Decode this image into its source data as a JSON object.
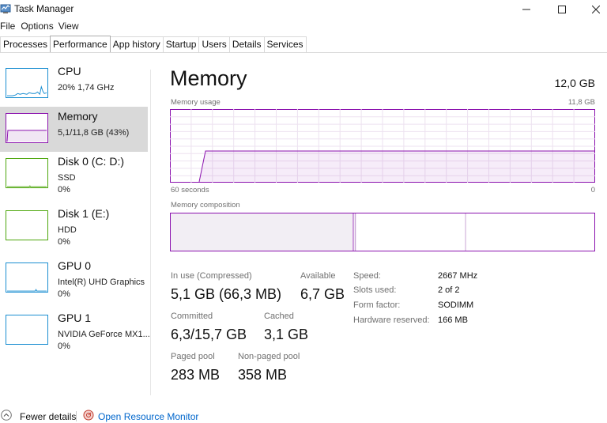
{
  "window": {
    "title": "Task Manager",
    "icon": "task-manager-icon",
    "controls": [
      "minimize-icon",
      "maximize-icon",
      "close-icon"
    ]
  },
  "menu": [
    "File",
    "Options",
    "View"
  ],
  "tabs": [
    {
      "label": "Processes",
      "active": false
    },
    {
      "label": "Performance",
      "active": true
    },
    {
      "label": "App history",
      "active": false
    },
    {
      "label": "Startup",
      "active": false
    },
    {
      "label": "Users",
      "active": false
    },
    {
      "label": "Details",
      "active": false
    },
    {
      "label": "Services",
      "active": false
    }
  ],
  "sidebar": [
    {
      "title": "CPU",
      "lines": [
        "20%  1,74 GHz"
      ],
      "color": "#1a8ed1",
      "selected": false
    },
    {
      "title": "Memory",
      "lines": [
        "5,1/11,8 GB (43%)"
      ],
      "color": "#8b12ae",
      "selected": true
    },
    {
      "title": "Disk 0 (C: D:)",
      "lines": [
        "SSD",
        "0%"
      ],
      "color": "#4da60c",
      "selected": false
    },
    {
      "title": "Disk 1 (E:)",
      "lines": [
        "HDD",
        "0%"
      ],
      "color": "#4da60c",
      "selected": false
    },
    {
      "title": "GPU 0",
      "lines": [
        "Intel(R) UHD Graphics",
        "0%"
      ],
      "color": "#1a8ed1",
      "selected": false
    },
    {
      "title": "GPU 1",
      "lines": [
        "NVIDIA GeForce MX1...",
        "0%"
      ],
      "color": "#1a8ed1",
      "selected": false
    }
  ],
  "main": {
    "title": "Memory",
    "capacity": "12,0 GB",
    "usage_label": "Memory usage",
    "usage_max": "11,8 GB",
    "axis_left": "60 seconds",
    "axis_right": "0",
    "composition_label": "Memory composition",
    "in_use_label": "In use (Compressed)",
    "in_use_value": "5,1 GB (66,3 MB)",
    "available_label": "Available",
    "available_value": "6,7 GB",
    "committed_label": "Committed",
    "committed_value": "6,3/15,7 GB",
    "cached_label": "Cached",
    "cached_value": "3,1 GB",
    "paged_label": "Paged pool",
    "paged_value": "283 MB",
    "nonpaged_label": "Non-paged pool",
    "nonpaged_value": "358 MB",
    "speed_label": "Speed:",
    "speed_value": "2667 MHz",
    "slots_label": "Slots used:",
    "slots_value": "2 of 2",
    "form_label": "Form factor:",
    "form_value": "SODIMM",
    "reserved_label": "Hardware reserved:",
    "reserved_value": "166 MB"
  },
  "memory_usage_fraction": 0.43,
  "composition_fractions": {
    "in_use": 0.43,
    "modified": 0.005,
    "standby": 0.26,
    "free": 0.305
  },
  "accent_color": "#8b12ae",
  "footer": {
    "fewer_details": "Fewer details",
    "open_monitor": "Open Resource Monitor",
    "fewer_icon": "chevron-up-icon",
    "monitor_icon": "resource-monitor-icon"
  }
}
